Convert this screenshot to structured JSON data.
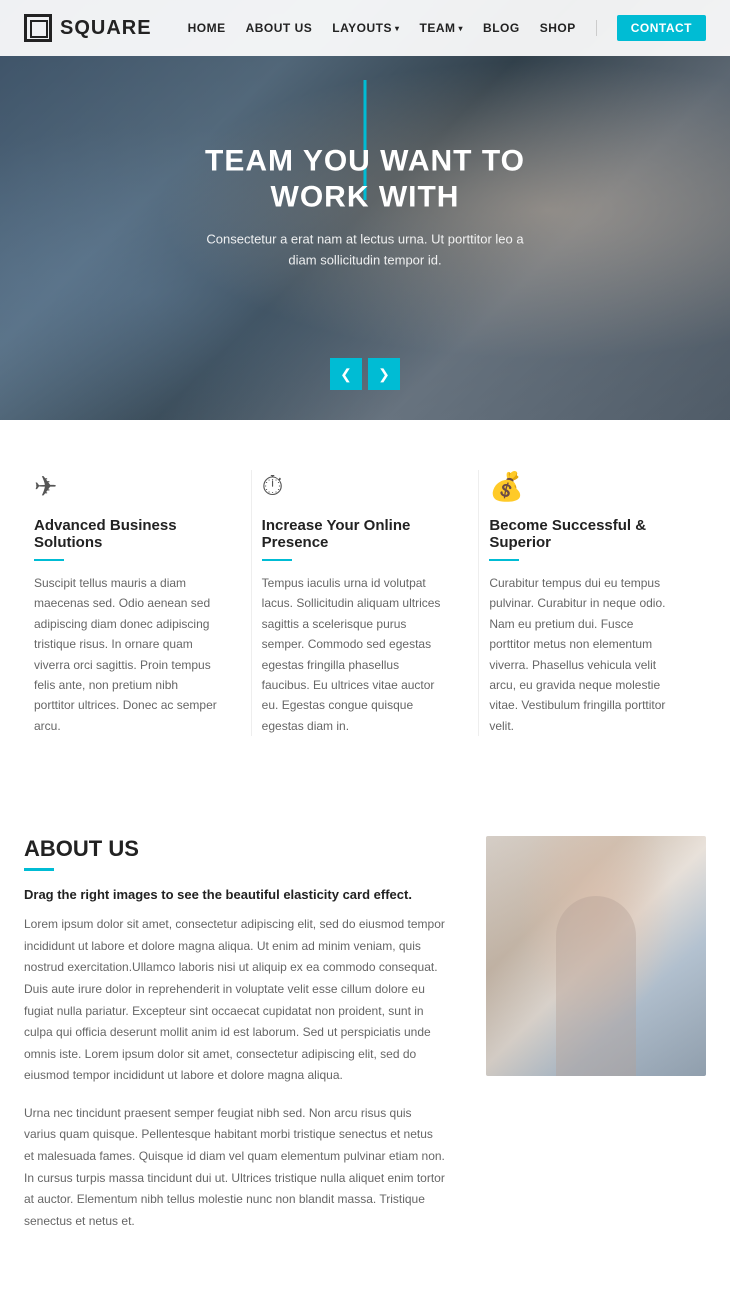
{
  "header": {
    "logo_text": "SQUARE",
    "nav": [
      {
        "label": "HOME",
        "href": "#",
        "type": "link"
      },
      {
        "label": "ABOUT US",
        "href": "#",
        "type": "link"
      },
      {
        "label": "LAYOUTS",
        "href": "#",
        "type": "dropdown"
      },
      {
        "label": "TEAM",
        "href": "#",
        "type": "dropdown"
      },
      {
        "label": "BLOG",
        "href": "#",
        "type": "link"
      },
      {
        "label": "SHOP",
        "href": "#",
        "type": "link"
      },
      {
        "label": "CONTACT",
        "href": "#",
        "type": "contact"
      }
    ]
  },
  "hero": {
    "title": "TEAM YOU WANT TO WORK WITH",
    "subtitle": "Consectetur a erat nam at lectus urna. Ut porttitor leo a diam sollicitudin tempor id.",
    "arrow_prev": "❮",
    "arrow_next": "❯"
  },
  "features": [
    {
      "icon": "✈",
      "title": "Advanced Business Solutions",
      "text": "Suscipit tellus mauris a diam maecenas sed. Odio aenean sed adipiscing diam donec adipiscing tristique risus. In ornare quam viverra orci sagittis. Proin tempus felis ante, non pretium nibh porttitor ultrices. Donec ac semper arcu."
    },
    {
      "icon": "⏱",
      "title": "Increase Your Online Presence",
      "text": "Tempus iaculis urna id volutpat lacus. Sollicitudin aliquam ultrices sagittis a scelerisque purus semper. Commodo sed egestas egestas fringilla phasellus faucibus. Eu ultrices vitae auctor eu. Egestas congue quisque egestas diam in."
    },
    {
      "icon": "💰",
      "title": "Become Successful & Superior",
      "text": "Curabitur tempus dui eu tempus pulvinar. Curabitur in neque odio. Nam eu pretium dui. Fusce porttitor metus non elementum viverra. Phasellus vehicula velit arcu, eu gravida neque molestie vitae. Vestibulum fringilla porttitor velit."
    }
  ],
  "about": {
    "section_label": "ABOUT US",
    "subtitle": "Drag the right images to see the beautiful elasticity card effect.",
    "text1": "Lorem ipsum dolor sit amet, consectetur adipiscing elit, sed do eiusmod tempor incididunt ut labore et dolore magna aliqua. Ut enim ad minim veniam, quis nostrud exercitation.Ullamco laboris nisi ut aliquip ex ea commodo consequat. Duis aute irure dolor in reprehenderit in voluptate velit esse cillum dolore eu fugiat nulla pariatur. Excepteur sint occaecat cupidatat non proident, sunt in culpa qui officia deserunt mollit anim id est laborum. Sed ut perspiciatis unde omnis iste. Lorem ipsum dolor sit amet, consectetur adipiscing elit, sed do eiusmod tempor incididunt ut labore et dolore magna aliqua.",
    "text2": "Urna nec tincidunt praesent semper feugiat nibh sed. Non arcu risus quis varius quam quisque. Pellentesque habitant morbi tristique senectus et netus et malesuada fames. Quisque id diam vel quam elementum pulvinar etiam non. In cursus turpis massa tincidunt dui ut. Ultrices tristique nulla aliquet enim tortor at auctor. Elementum nibh tellus molestie nunc non blandit massa. Tristique senectus et netus et."
  }
}
